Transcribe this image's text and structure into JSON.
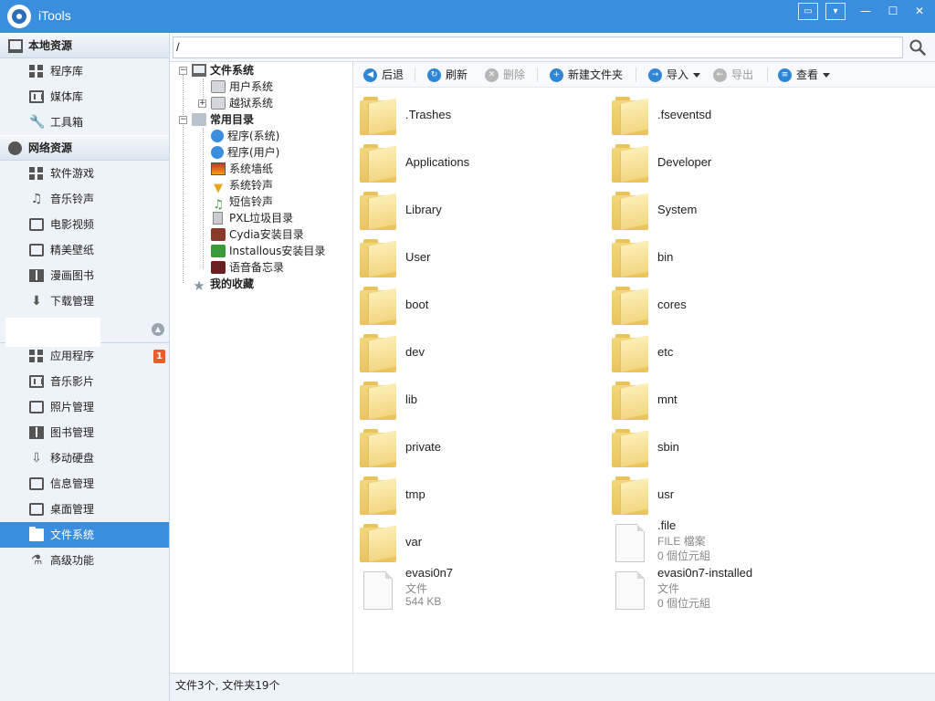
{
  "app": {
    "title": "iTools"
  },
  "window_controls": [
    "chat-icon",
    "menu-icon",
    "minimize-icon",
    "maximize-icon",
    "close-icon"
  ],
  "sidebar": {
    "local": {
      "title": "本地资源",
      "items": [
        {
          "label": "程序库",
          "icon": "grid-icon"
        },
        {
          "label": "媒体库",
          "icon": "film-icon"
        },
        {
          "label": "工具箱",
          "icon": "wrench-icon"
        }
      ]
    },
    "network": {
      "title": "网络资源",
      "items": [
        {
          "label": "软件游戏",
          "icon": "grid-icon"
        },
        {
          "label": "音乐铃声",
          "icon": "music-icon"
        },
        {
          "label": "电影视频",
          "icon": "video-icon"
        },
        {
          "label": "精美壁纸",
          "icon": "wallpaper-icon"
        },
        {
          "label": "漫画图书",
          "icon": "book-icon"
        },
        {
          "label": "下载管理",
          "icon": "download-icon"
        }
      ]
    },
    "device": {
      "items": [
        {
          "label": "应用程序",
          "icon": "grid-icon",
          "badge": "1"
        },
        {
          "label": "音乐影片",
          "icon": "film-icon"
        },
        {
          "label": "照片管理",
          "icon": "photo-icon"
        },
        {
          "label": "图书管理",
          "icon": "book-icon"
        },
        {
          "label": "移动硬盘",
          "icon": "disk-icon"
        },
        {
          "label": "信息管理",
          "icon": "contacts-icon"
        },
        {
          "label": "桌面管理",
          "icon": "desktop-icon"
        },
        {
          "label": "文件系统",
          "icon": "folder-icon",
          "active": true
        },
        {
          "label": "高级功能",
          "icon": "flask-icon"
        }
      ]
    }
  },
  "address": {
    "path": "/"
  },
  "tree": {
    "filesystem": {
      "label": "文件系统",
      "children": [
        "用户系统",
        "越狱系统"
      ]
    },
    "common": {
      "label": "常用目录",
      "children": [
        "程序(系统)",
        "程序(用户)",
        "系统墙纸",
        "系统铃声",
        "短信铃声",
        "PXL垃圾目录",
        "Cydia安装目录",
        "Installous安装目录",
        "语音备忘录"
      ]
    },
    "favorites": {
      "label": "我的收藏"
    }
  },
  "toolbar": {
    "back": "后退",
    "refresh": "刷新",
    "delete": "删除",
    "new_folder": "新建文件夹",
    "import": "导入",
    "export": "导出",
    "view": "查看"
  },
  "files": [
    {
      "name": ".Trashes",
      "kind": "folder"
    },
    {
      "name": ".fseventsd",
      "kind": "folder"
    },
    {
      "name": "Applications",
      "kind": "folder"
    },
    {
      "name": "Developer",
      "kind": "folder"
    },
    {
      "name": "Library",
      "kind": "folder"
    },
    {
      "name": "System",
      "kind": "folder"
    },
    {
      "name": "User",
      "kind": "folder"
    },
    {
      "name": "bin",
      "kind": "folder"
    },
    {
      "name": "boot",
      "kind": "folder"
    },
    {
      "name": "cores",
      "kind": "folder"
    },
    {
      "name": "dev",
      "kind": "folder"
    },
    {
      "name": "etc",
      "kind": "folder"
    },
    {
      "name": "lib",
      "kind": "folder"
    },
    {
      "name": "mnt",
      "kind": "folder"
    },
    {
      "name": "private",
      "kind": "folder"
    },
    {
      "name": "sbin",
      "kind": "folder"
    },
    {
      "name": "tmp",
      "kind": "folder"
    },
    {
      "name": "usr",
      "kind": "folder"
    },
    {
      "name": "var",
      "kind": "folder"
    },
    {
      "name": ".file",
      "kind": "file",
      "type": "FILE 檔案",
      "size": "0 個位元組"
    },
    {
      "name": "evasi0n7",
      "kind": "file",
      "type": "文件",
      "size": "544 KB"
    },
    {
      "name": "evasi0n7-installed",
      "kind": "file",
      "type": "文件",
      "size": "0 個位元組"
    }
  ],
  "status": {
    "text": "文件3个, 文件夹19个"
  }
}
